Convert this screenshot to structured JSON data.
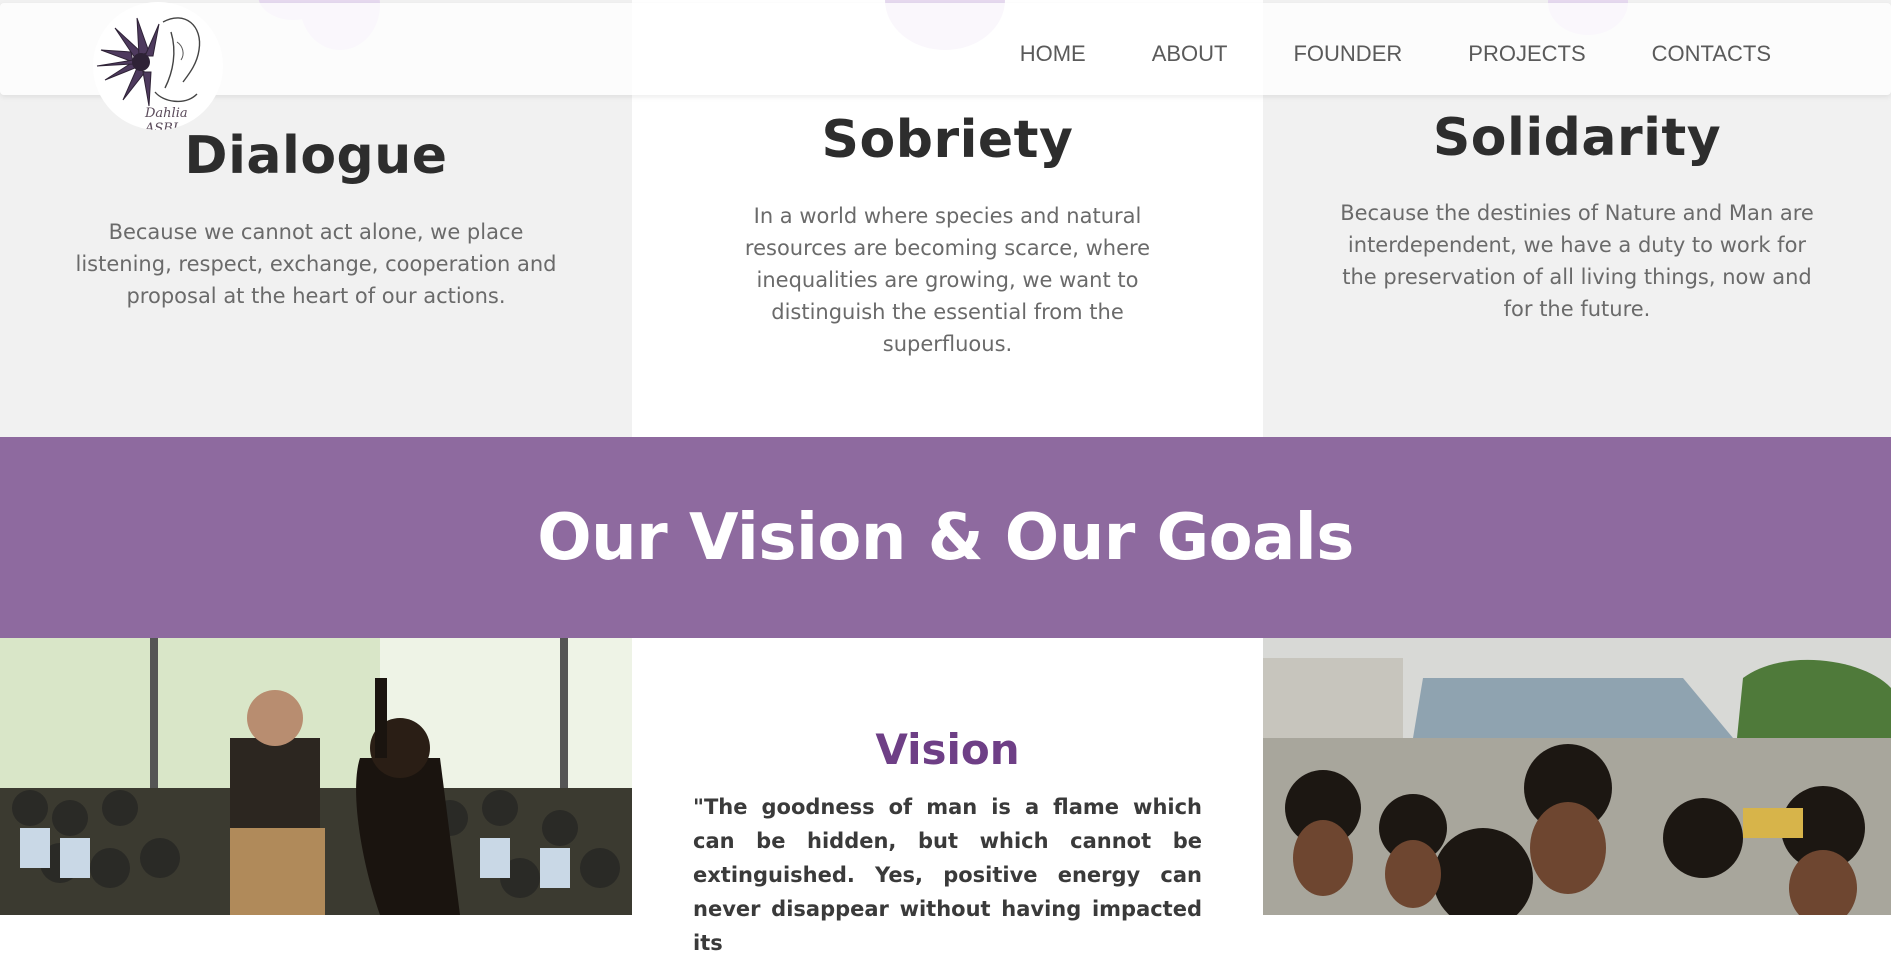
{
  "header": {
    "logo_text": "Dahlia ASBL",
    "nav": [
      "HOME",
      "ABOUT",
      "FOUNDER",
      "PROJECTS",
      "CONTACTS"
    ]
  },
  "values": [
    {
      "title": "Dialogue",
      "text": "Because we cannot act alone, we place listening, respect, exchange, cooperation and proposal at the heart of our actions."
    },
    {
      "title": "Sobriety",
      "text": "In a world where species and natural resources are becoming scarce, where inequalities are growing, we want to distinguish the essential from the superfluous."
    },
    {
      "title": "Solidarity",
      "text": "Because the destinies of Nature and Man are interdependent, we have a duty to work for the preservation of all living things, now and for the future."
    }
  ],
  "band": {
    "title": "Our Vision & Our Goals"
  },
  "vision": {
    "title": "Vision",
    "quote": "\"The goodness of man is a flame which can be hidden, but which cannot be extinguished. Yes, positive energy can never disappear without having impacted its"
  },
  "colors": {
    "accent": "#8e6a9f",
    "vision_title": "#6e3f86",
    "grey_panel": "#f1f1f1"
  }
}
